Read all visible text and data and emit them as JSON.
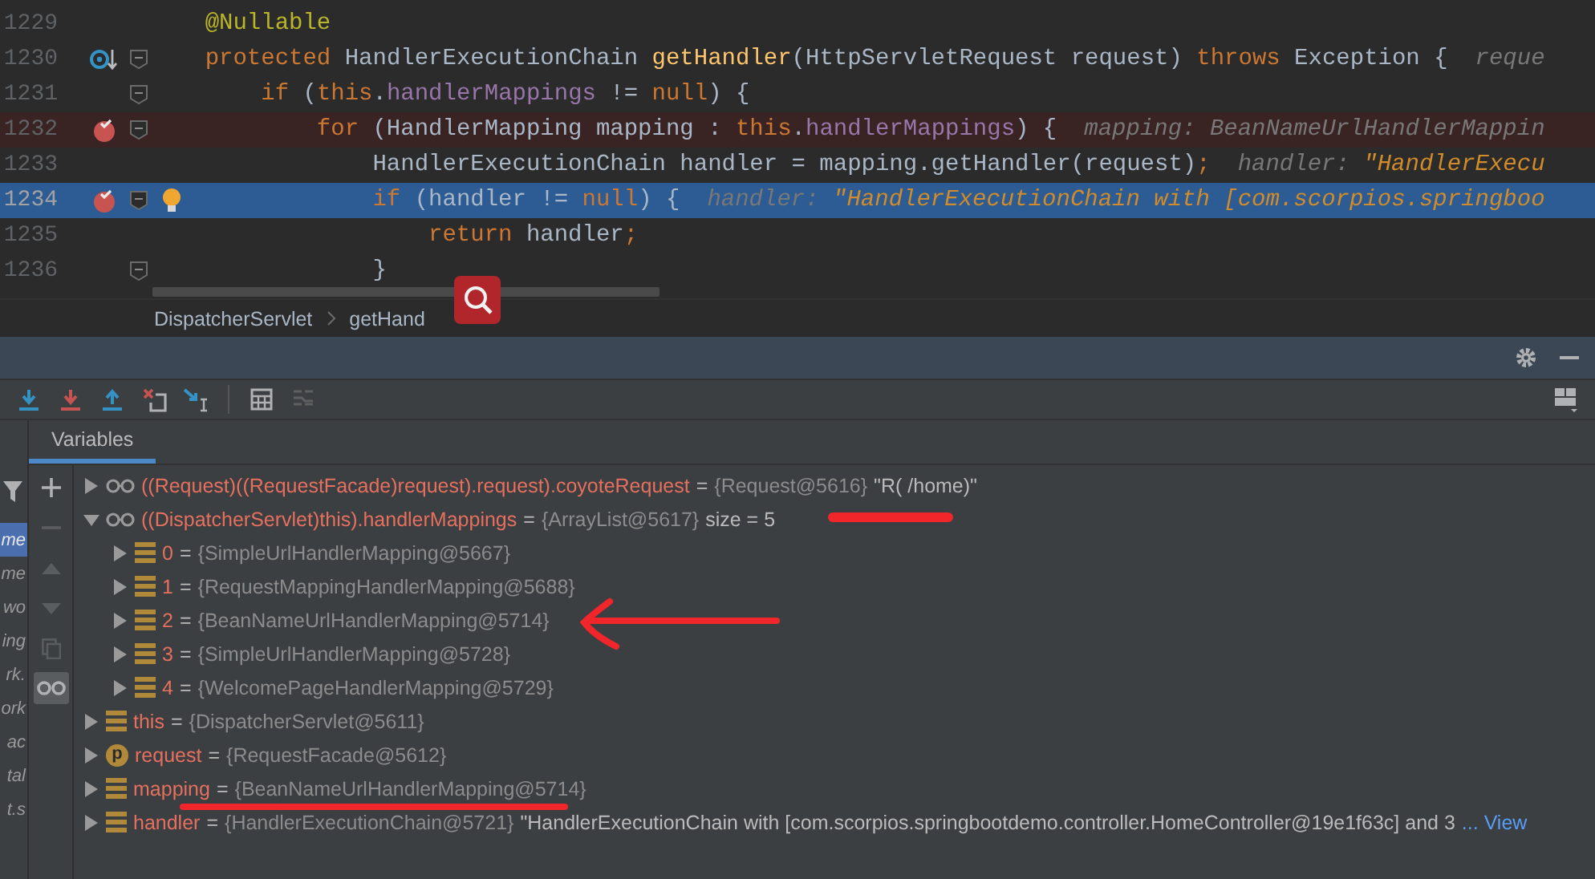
{
  "editor": {
    "lines": [
      {
        "number": "1229",
        "kind": "plain",
        "fold": false,
        "current": false,
        "bulb": false,
        "tokens": [
          {
            "text": "    @Nullable",
            "kind": "annotation"
          }
        ]
      },
      {
        "number": "1230",
        "kind": "method",
        "fold": true,
        "current": false,
        "bulb": false,
        "tokens": [
          {
            "text": "    protected",
            "kind": "keyword"
          },
          {
            "text": " HandlerExecutionChain ",
            "kind": "plain"
          },
          {
            "text": "getHandler",
            "kind": "method"
          },
          {
            "text": "(HttpServletRequest request) ",
            "kind": "plain"
          },
          {
            "text": "throws",
            "kind": "keyword"
          },
          {
            "text": " Exception {",
            "kind": "plain"
          }
        ],
        "hint": [
          {
            "text": "reque",
            "kind": "hint"
          }
        ]
      },
      {
        "number": "1231",
        "kind": "plain",
        "fold": true,
        "current": false,
        "bulb": false,
        "tokens": [
          {
            "text": "        if",
            "kind": "keyword"
          },
          {
            "text": " (",
            "kind": "plain"
          },
          {
            "text": "this",
            "kind": "keyword"
          },
          {
            "text": ".",
            "kind": "plain"
          },
          {
            "text": "handlerMappings",
            "kind": "field"
          },
          {
            "text": " != ",
            "kind": "plain"
          },
          {
            "text": "null",
            "kind": "keyword"
          },
          {
            "text": ") {",
            "kind": "plain"
          }
        ]
      },
      {
        "number": "1232",
        "kind": "breakpoint",
        "fold": true,
        "current": false,
        "bulb": false,
        "tokens": [
          {
            "text": "            for",
            "kind": "keyword"
          },
          {
            "text": " (HandlerMapping mapping : ",
            "kind": "plain"
          },
          {
            "text": "this",
            "kind": "keyword"
          },
          {
            "text": ".",
            "kind": "plain"
          },
          {
            "text": "handlerMappings",
            "kind": "field"
          },
          {
            "text": ") {",
            "kind": "plain"
          }
        ],
        "hint": [
          {
            "text": "mapping: BeanNameUrlHandlerMappin",
            "kind": "hint"
          }
        ]
      },
      {
        "number": "1233",
        "kind": "plain",
        "fold": false,
        "current": false,
        "bulb": false,
        "tokens": [
          {
            "text": "                HandlerExecutionChain handler = mapping.getHandler(request)",
            "kind": "plain"
          },
          {
            "text": ";",
            "kind": "keyword"
          }
        ],
        "hint": [
          {
            "text": "handler: ",
            "kind": "hint"
          },
          {
            "text": "\"HandlerExecu",
            "kind": "hint-string"
          }
        ]
      },
      {
        "number": "1234",
        "kind": "breakpoint",
        "fold": true,
        "current": true,
        "bulb": true,
        "tokens": [
          {
            "text": "                if",
            "kind": "keyword"
          },
          {
            "text": " (handler != ",
            "kind": "plain"
          },
          {
            "text": "null",
            "kind": "keyword"
          },
          {
            "text": ") {",
            "kind": "plain"
          }
        ],
        "hint": [
          {
            "text": "handler: ",
            "kind": "hint"
          },
          {
            "text": "\"HandlerExecutionChain with [com.scorpios.springboo",
            "kind": "hint-string"
          }
        ]
      },
      {
        "number": "1235",
        "kind": "plain",
        "fold": false,
        "current": false,
        "bulb": false,
        "tokens": [
          {
            "text": "                    return",
            "kind": "keyword"
          },
          {
            "text": " handler",
            "kind": "plain"
          },
          {
            "text": ";",
            "kind": "keyword"
          }
        ]
      },
      {
        "number": "1236",
        "kind": "plain",
        "fold": true,
        "current": false,
        "bulb": false,
        "tokens": [
          {
            "text": "                }",
            "kind": "plain"
          }
        ]
      }
    ]
  },
  "breadcrumbs": [
    "DispatcherServlet",
    "getHand"
  ],
  "toolbar": [
    {
      "kind": "step-over"
    },
    {
      "kind": "force-step-into"
    },
    {
      "kind": "step-out"
    },
    {
      "kind": "drop-frame"
    },
    {
      "kind": "run-to-cursor"
    },
    {
      "kind": "separator"
    },
    {
      "kind": "evaluate"
    },
    {
      "kind": "trace"
    }
  ],
  "frames": [
    {
      "text": "me",
      "selected": true
    },
    {
      "text": "me",
      "selected": false
    },
    {
      "text": "wo",
      "selected": false
    },
    {
      "text": "ing",
      "selected": false
    },
    {
      "text": "rk.",
      "selected": false
    },
    {
      "text": "ork",
      "selected": false
    },
    {
      "text": "ac",
      "selected": false
    },
    {
      "text": "tal",
      "selected": false
    },
    {
      "text": "t.s",
      "selected": false
    }
  ],
  "variables_tab": {
    "label": "Variables",
    "selected": true
  },
  "side_tools": [
    {
      "kind": "add",
      "disabled": false,
      "selected": false
    },
    {
      "kind": "remove",
      "disabled": true,
      "selected": false
    },
    {
      "kind": "up",
      "disabled": true,
      "selected": false
    },
    {
      "kind": "down",
      "disabled": true,
      "selected": false
    },
    {
      "kind": "copy",
      "disabled": true,
      "selected": false
    },
    {
      "kind": "watches",
      "disabled": false,
      "selected": true
    }
  ],
  "variables": [
    {
      "kind": "watch",
      "name": "((Request)((RequestFacade)request).request).coyoteRequest",
      "op": "=",
      "value": "{Request@5616}",
      "extra": "\"R( /home)\"",
      "expanded": false
    },
    {
      "kind": "watch",
      "name": "((DispatcherServlet)this).handlerMappings",
      "op": "=",
      "value": "{ArrayList@5617}",
      "extra": "size = 5",
      "expanded": true,
      "children": [
        {
          "kind": "field",
          "name": "0",
          "op": "=",
          "value": "{SimpleUrlHandlerMapping@5667}",
          "expanded": false
        },
        {
          "kind": "field",
          "name": "1",
          "op": "=",
          "value": "{RequestMappingHandlerMapping@5688}",
          "expanded": false
        },
        {
          "kind": "field",
          "name": "2",
          "op": "=",
          "value": "{BeanNameUrlHandlerMapping@5714}",
          "expanded": false
        },
        {
          "kind": "field",
          "name": "3",
          "op": "=",
          "value": "{SimpleUrlHandlerMapping@5728}",
          "expanded": false
        },
        {
          "kind": "field",
          "name": "4",
          "op": "=",
          "value": "{WelcomePageHandlerMapping@5729}",
          "expanded": false
        }
      ]
    },
    {
      "kind": "field",
      "name": "this",
      "op": "=",
      "value": "{DispatcherServlet@5611}",
      "expanded": false
    },
    {
      "kind": "param",
      "badge": "p",
      "name": "request",
      "op": "=",
      "value": "{RequestFacade@5612}",
      "expanded": false
    },
    {
      "kind": "field",
      "name": "mapping",
      "op": "=",
      "value": "{BeanNameUrlHandlerMapping@5714}",
      "expanded": false
    },
    {
      "kind": "field",
      "name": "handler",
      "op": "=",
      "value": "{HandlerExecutionChain@5721}",
      "extra": "\"HandlerExecutionChain with [com.scorpios.springbootdemo.controller.HomeController@19e1f63c] and 3",
      "link": "... View",
      "expanded": false
    }
  ]
}
